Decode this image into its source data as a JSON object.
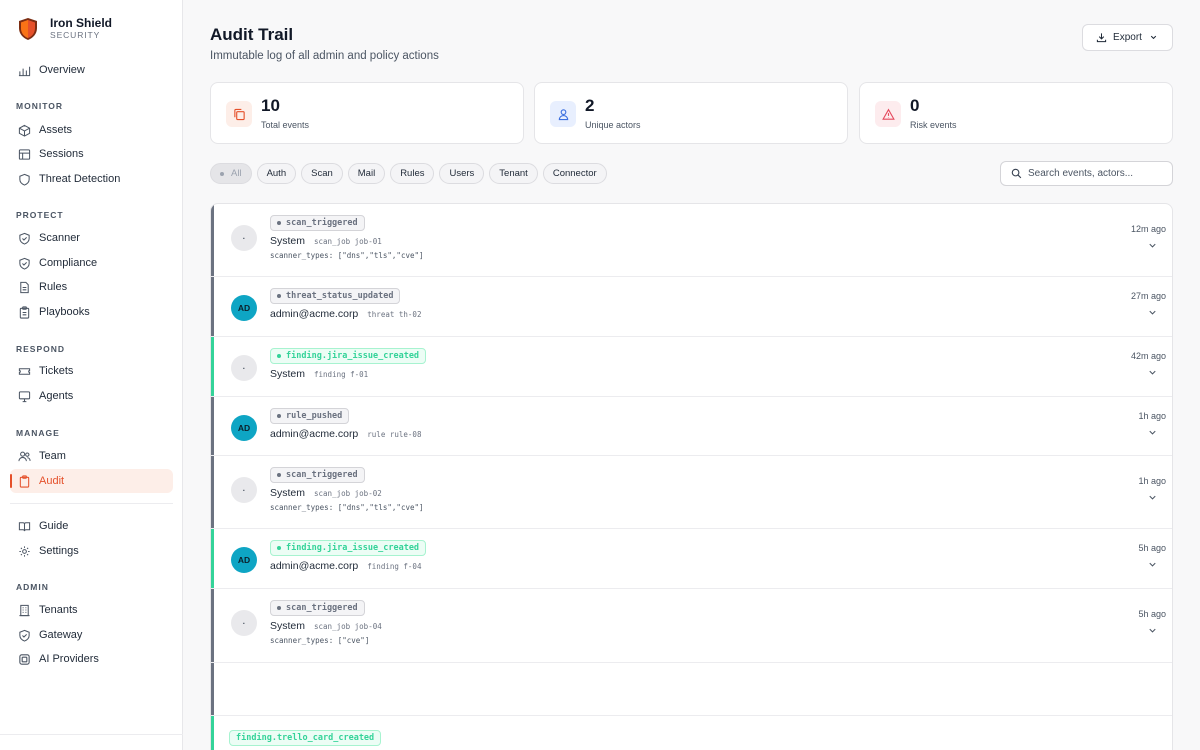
{
  "brand": {
    "name": "Iron Shield",
    "sub": "SECURITY",
    "logo_colors": [
      "#e5502a",
      "#7c2d12"
    ]
  },
  "sidebar": {
    "overview": {
      "label": "Overview",
      "icon": "bar-chart-icon"
    },
    "monitor": {
      "title": "MONITOR",
      "items": [
        {
          "label": "Assets",
          "icon": "cube-icon"
        },
        {
          "label": "Sessions",
          "icon": "table-icon"
        },
        {
          "label": "Threat Detection",
          "icon": "shield-icon"
        }
      ]
    },
    "protect": {
      "title": "PROTECT",
      "items": [
        {
          "label": "Scanner",
          "icon": "shield-check-icon"
        },
        {
          "label": "Compliance",
          "icon": "shield-check-icon"
        },
        {
          "label": "Rules",
          "icon": "document-icon"
        },
        {
          "label": "Playbooks",
          "icon": "clipboard-icon"
        }
      ]
    },
    "respond": {
      "title": "RESPOND",
      "items": [
        {
          "label": "Tickets",
          "icon": "ticket-icon"
        },
        {
          "label": "Agents",
          "icon": "monitor-icon"
        }
      ]
    },
    "manage": {
      "title": "MANAGE",
      "items": [
        {
          "label": "Team",
          "icon": "users-icon"
        },
        {
          "label": "Audit",
          "icon": "clipboard-icon",
          "active": true
        }
      ]
    },
    "extra": [
      {
        "label": "Guide",
        "icon": "book-icon"
      },
      {
        "label": "Settings",
        "icon": "gear-icon"
      }
    ],
    "admin": {
      "title": "ADMIN",
      "items": [
        {
          "label": "Tenants",
          "icon": "building-icon"
        },
        {
          "label": "Gateway",
          "icon": "shield-check-icon"
        },
        {
          "label": "AI Providers",
          "icon": "chip-icon"
        }
      ]
    }
  },
  "header": {
    "title": "Audit Trail",
    "subtitle": "Immutable log of all admin and policy actions",
    "export_label": "Export"
  },
  "stats": [
    {
      "value": "10",
      "label": "Total events",
      "icon": "copy-icon",
      "bg": "#fdeee8",
      "fg": "#e5502a"
    },
    {
      "value": "2",
      "label": "Unique actors",
      "icon": "user-icon",
      "bg": "#e8effe",
      "fg": "#3b6fe0"
    },
    {
      "value": "0",
      "label": "Risk events",
      "icon": "alert-triangle-icon",
      "bg": "#fdecee",
      "fg": "#e5485d"
    }
  ],
  "filters": {
    "chips": [
      "All",
      "Auth",
      "Scan",
      "Mail",
      "Rules",
      "Users",
      "Tenant",
      "Connector"
    ],
    "active": "All"
  },
  "search": {
    "placeholder": "Search events, actors..."
  },
  "events": [
    {
      "action": "scan_triggered",
      "actor": "System",
      "avatar": "·",
      "target": "scan_job job-01",
      "meta": "scanner_types: [\"dns\",\"tls\",\"cve\"]",
      "time": "12m ago",
      "tone": "gray"
    },
    {
      "action": "threat_status_updated",
      "actor": "admin@acme.corp",
      "avatar": "AD",
      "target": "threat th-02",
      "meta": "",
      "time": "27m ago",
      "tone": "gray"
    },
    {
      "action": "finding.jira_issue_created",
      "actor": "System",
      "avatar": "·",
      "target": "finding f-01",
      "meta": "",
      "time": "42m ago",
      "tone": "green"
    },
    {
      "action": "rule_pushed",
      "actor": "admin@acme.corp",
      "avatar": "AD",
      "target": "rule rule-08",
      "meta": "",
      "time": "1h ago",
      "tone": "gray"
    },
    {
      "action": "scan_triggered",
      "actor": "System",
      "avatar": "·",
      "target": "scan_job job-02",
      "meta": "scanner_types: [\"dns\",\"tls\",\"cve\"]",
      "time": "1h ago",
      "tone": "gray"
    },
    {
      "action": "finding.jira_issue_created",
      "actor": "admin@acme.corp",
      "avatar": "AD",
      "target": "finding f-04",
      "meta": "",
      "time": "5h ago",
      "tone": "green"
    },
    {
      "action": "scan_triggered",
      "actor": "System",
      "avatar": "·",
      "target": "scan_job job-04",
      "meta": "scanner_types: [\"cve\"]",
      "time": "5h ago",
      "tone": "gray"
    },
    {
      "action": "",
      "actor": "",
      "avatar": "",
      "target": "",
      "meta": "",
      "time": "",
      "tone": "gray"
    },
    {
      "action": "finding.trello_card_created",
      "actor": "",
      "avatar": "",
      "target": "",
      "meta": "",
      "time": "",
      "tone": "green"
    }
  ]
}
